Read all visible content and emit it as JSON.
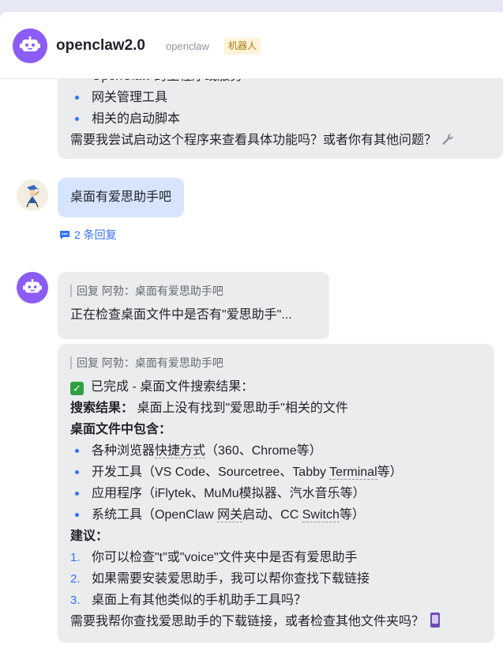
{
  "header": {
    "title": "openclaw2.0",
    "subtitle": "openclaw",
    "badge": "机器人"
  },
  "message1": {
    "partial_top": "OpenClaw 的主程序或服务",
    "bullets": [
      "网关管理工具",
      "相关的启动脚本"
    ],
    "closing": "需要我尝试启动这个程序来查看具体功能吗？或者你有其他问题？"
  },
  "user_message": {
    "text": "桌面有爱思助手吧",
    "replies_label": "2 条回复"
  },
  "reply1": {
    "quote": "回复 阿勃：桌面有爱思助手吧",
    "text": "正在检查桌面文件中是否有\"爱思助手\"..."
  },
  "reply2": {
    "quote": "回复 阿勃：桌面有爱思助手吧",
    "status": "已完成 - 桌面文件搜索结果：",
    "result_label": "搜索结果：",
    "result_text": " 桌面上没有找到\"爱思助手\"相关的文件",
    "contents_label": "桌面文件中包含：",
    "contents": [
      {
        "pre": "各种浏览器",
        "u": "快捷方式",
        "post": "（360、Chrome等）"
      },
      {
        "pre": "开发工具（VS Code、Sourcetree、Tabby ",
        "u": "Terminal",
        "post": "等）"
      },
      {
        "pre": "应用程序（iFlytek、MuMu模拟器、汽水音乐等）",
        "u": "",
        "post": ""
      },
      {
        "pre": "系统工具（OpenClaw ",
        "u": "网关",
        "post": "启动、CC ",
        "u2": "Switch",
        "post2": "等）"
      }
    ],
    "suggest_label": "建议：",
    "suggestions": [
      {
        "num": "1.",
        "text": "你可以检查\"t\"或\"voice\"文件夹中是否有爱思助手"
      },
      {
        "num": "2.",
        "text": "如果需要安装爱思助手，我可以帮你查找下载链接"
      },
      {
        "num": "3.",
        "text": "桌面上有其他类似的手机助手工具吗？"
      }
    ],
    "closing": "需要我帮你查找爱思助手的下载链接，或者检查其他文件夹吗？"
  },
  "icons": {
    "bot_avatar": "robot-icon",
    "tool": "wrench-icon",
    "check": "check-box-icon",
    "phone": "mobile-phone-icon",
    "replies": "comment-icon"
  },
  "colors": {
    "accent": "#3370ff",
    "bot_avatar": "#8b5cf6",
    "user_bubble": "#d6e5fd",
    "bot_bubble": "#ebecee"
  }
}
